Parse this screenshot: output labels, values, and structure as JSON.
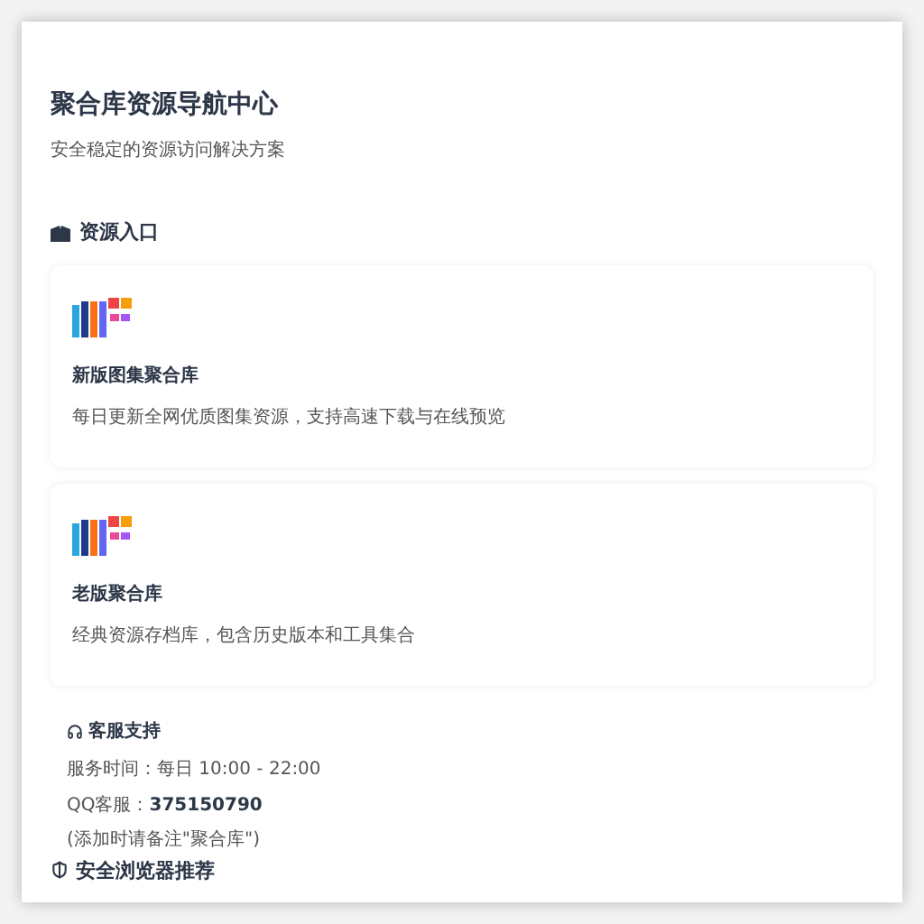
{
  "header": {
    "title": "聚合库资源导航中心",
    "subtitle": "安全稳定的资源访问解决方案"
  },
  "resources": {
    "heading": "资源入口",
    "cards": [
      {
        "title": "新版图集聚合库",
        "description": "每日更新全网优质图集资源，支持高速下载与在线预览"
      },
      {
        "title": "老版聚合库",
        "description": "经典资源存档库，包含历史版本和工具集合"
      }
    ]
  },
  "support": {
    "heading": "客服支持",
    "hours": "服务时间：每日 10:00 - 22:00",
    "qq_label": "QQ客服：",
    "qq_number": "375150790",
    "note": "(添加时请备注\"聚合库\")"
  },
  "browsers": {
    "heading": "安全浏览器推荐"
  }
}
